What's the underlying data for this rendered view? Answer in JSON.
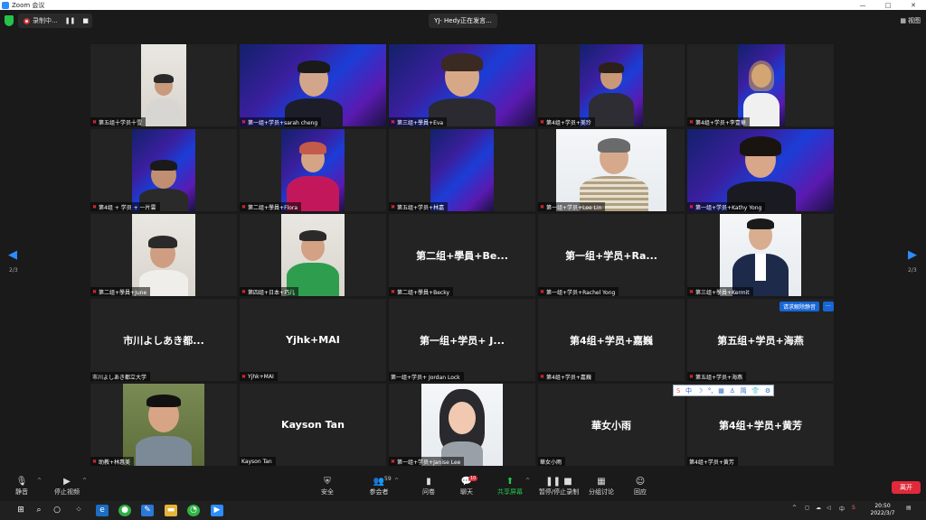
{
  "window": {
    "title": "Zoom 会议",
    "minimize": "—",
    "maximize": "□",
    "close": "✕"
  },
  "topbar": {
    "recording_label": "录制中...",
    "pause_glyph": "❚❚",
    "stop_glyph": "■",
    "speaking": "YJ- Hedy正在发言...",
    "view_label": "视图"
  },
  "tiles": [
    {
      "name": "第五组十学员十雪"
    },
    {
      "name": "第一组+学员+sarah cheng"
    },
    {
      "name": "第三组+學員+Eva"
    },
    {
      "name": "第4组+学员+美玲"
    },
    {
      "name": "第4组+学员+李壹華"
    },
    {
      "name": "第4组 + 学员 + 一片雲"
    },
    {
      "name": "第二组+學員+Flora"
    },
    {
      "name": "第五组+学员+林嘉"
    },
    {
      "name": "第一组+学员+Lee Lin"
    },
    {
      "name": "第一组+学员+Kathy Yong"
    },
    {
      "name": "第二组+學員+June"
    },
    {
      "name": "第四组+日本+巧儿"
    },
    {
      "name": "第二组+學員+Becky",
      "display": "第二组+學員+Be..."
    },
    {
      "name": "第一组+学员+Rachel Yong",
      "display": "第一组+学员+Ra..."
    },
    {
      "name": "第三组+學員+Kermit"
    },
    {
      "name": "市川よしあき都立大学",
      "display": "市川よしあき都..."
    },
    {
      "name": "Yjhk+MAI",
      "display": "Yjhk+MAI"
    },
    {
      "name": "第一组+学员+ Jordan Lock",
      "display": "第一组+学员+ J..."
    },
    {
      "name": "第4组+学员+嘉巍",
      "display": "第4组+学员+嘉巍"
    },
    {
      "name": "第五组+学员+海燕",
      "display": "第五组+学员+海燕"
    },
    {
      "name": "助教+林惠美"
    },
    {
      "name": "Kayson Tan",
      "display": "Kayson Tan"
    },
    {
      "name": "第一组+学员+Janise Lee"
    },
    {
      "name": "華女小雨",
      "display": "華女小雨"
    },
    {
      "name": "第4组+学员+黄芳",
      "display": "第4组+学员+黄芳"
    }
  ],
  "unmute_request": "请求解除静音",
  "unmute_more": "···",
  "ime": {
    "items": [
      "中",
      "☽",
      "°,",
      "▦",
      "♙",
      "简",
      "👕",
      "⚙"
    ]
  },
  "pager": {
    "left": "◀",
    "right": "▶",
    "page": "2/3"
  },
  "toolbar": {
    "mute": "静音",
    "stop_video": "停止视频",
    "security": "安全",
    "participants": "参会者",
    "participants_count": "59",
    "polls": "问卷",
    "chat": "聊天",
    "chat_badge": "10",
    "share": "共享屏幕",
    "record": "暂停/停止录制",
    "breakout": "分组讨论",
    "reactions": "回应",
    "leave": "离开"
  },
  "taskbar": {
    "time": "20:50",
    "date": "2022/3/7",
    "ime_lang": "中",
    "ime_s": "S"
  },
  "colors": {
    "accent": "#2d8cff",
    "mute_red": "#e0293a",
    "share_green": "#24c34a",
    "leave_red": "#e0293a"
  }
}
